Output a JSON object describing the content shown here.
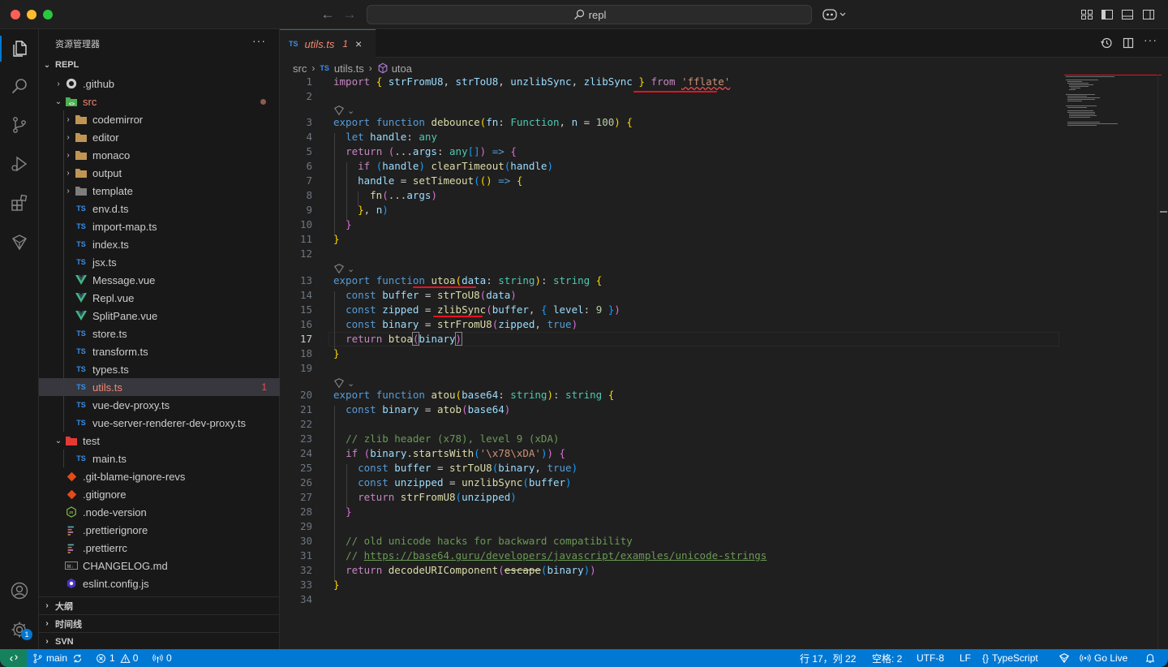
{
  "titlebar": {
    "search_text": "repl"
  },
  "sidebar": {
    "title": "资源管理器",
    "more": "···",
    "root": "REPL",
    "sections": {
      "outline": "大纲",
      "timeline": "时间线",
      "svn": "SVN"
    },
    "tree": [
      {
        "label": ".github",
        "count": ""
      },
      {
        "label": "src",
        "count": ""
      },
      {
        "label": "codemirror",
        "count": ""
      },
      {
        "label": "editor",
        "count": ""
      },
      {
        "label": "monaco",
        "count": ""
      },
      {
        "label": "output",
        "count": ""
      },
      {
        "label": "template",
        "count": ""
      },
      {
        "label": "env.d.ts",
        "count": ""
      },
      {
        "label": "import-map.ts",
        "count": ""
      },
      {
        "label": "index.ts",
        "count": ""
      },
      {
        "label": "jsx.ts",
        "count": ""
      },
      {
        "label": "Message.vue",
        "count": ""
      },
      {
        "label": "Repl.vue",
        "count": ""
      },
      {
        "label": "SplitPane.vue",
        "count": ""
      },
      {
        "label": "store.ts",
        "count": ""
      },
      {
        "label": "transform.ts",
        "count": ""
      },
      {
        "label": "types.ts",
        "count": ""
      },
      {
        "label": "utils.ts",
        "count": "1"
      },
      {
        "label": "vue-dev-proxy.ts",
        "count": ""
      },
      {
        "label": "vue-server-renderer-dev-proxy.ts",
        "count": ""
      },
      {
        "label": "test",
        "count": ""
      },
      {
        "label": "main.ts",
        "count": ""
      },
      {
        "label": ".git-blame-ignore-revs",
        "count": ""
      },
      {
        "label": ".gitignore",
        "count": ""
      },
      {
        "label": ".node-version",
        "count": ""
      },
      {
        "label": ".prettierignore",
        "count": ""
      },
      {
        "label": ".prettierrc",
        "count": ""
      },
      {
        "label": "CHANGELOG.md",
        "count": ""
      },
      {
        "label": "eslint.config.js",
        "count": ""
      }
    ]
  },
  "editor": {
    "tab": {
      "lang": "TS",
      "name": "utils.ts",
      "problems": "1",
      "close": "×"
    },
    "breadcrumb": {
      "root": "src",
      "sep": "›",
      "lang": "TS",
      "file": "utils.ts",
      "symbol": "utoa"
    },
    "line_numbers": [
      "1",
      "2",
      "3",
      "4",
      "5",
      "6",
      "7",
      "8",
      "9",
      "10",
      "11",
      "12",
      "13",
      "14",
      "15",
      "16",
      "17",
      "18",
      "19",
      "20",
      "21",
      "22",
      "23",
      "24",
      "25",
      "26",
      "27",
      "28",
      "29",
      "30",
      "31",
      "32",
      "33",
      "34"
    ],
    "active_line": "17",
    "code": {
      "l1": "import { strFromU8, strToU8, unzlibSync, zlibSync } from 'fflate'",
      "l3": "export function debounce(fn: Function, n = 100) {",
      "l4": "  let handle: any",
      "l5": "  return (...args: any[]) => {",
      "l6": "    if (handle) clearTimeout(handle)",
      "l7": "    handle = setTimeout(() => {",
      "l8": "      fn(...args)",
      "l9": "    }, n)",
      "l10": "  }",
      "l11": "}",
      "l13": "export function utoa(data: string): string {",
      "l14": "  const buffer = strToU8(data)",
      "l15": "  const zipped = zlibSync(buffer, { level: 9 })",
      "l16": "  const binary = strFromU8(zipped, true)",
      "l17": "  return btoa(binary)",
      "l18": "}",
      "l20": "export function atou(base64: string): string {",
      "l21": "  const binary = atob(base64)",
      "l23": "  // zlib header (x78), level 9 (xDA)",
      "l24": "  if (binary.startsWith('\\x78\\xDA')) {",
      "l25": "    const buffer = strToU8(binary, true)",
      "l26": "    const unzipped = unzlibSync(buffer)",
      "l27": "    return strFromU8(unzipped)",
      "l28": "  }",
      "l30": "  // old unicode hacks for backward compatibility",
      "l31": "  // https://base64.guru/developers/javascript/examples/unicode-strings",
      "l32": "  return decodeURIComponent(escape(binary))",
      "l33": "}"
    }
  },
  "statusbar": {
    "branch": "main",
    "errors": "1",
    "warnings": "0",
    "ports": "0",
    "position": "行 17，列 22",
    "spaces": "空格: 2",
    "encoding": "UTF-8",
    "eol": "LF",
    "language": "TypeScript",
    "golive": "Go Live"
  },
  "accounts_badge": "1",
  "colors": {
    "accent": "#0078d4",
    "error": "#f14c4c",
    "annotation_red": "#e81123"
  }
}
